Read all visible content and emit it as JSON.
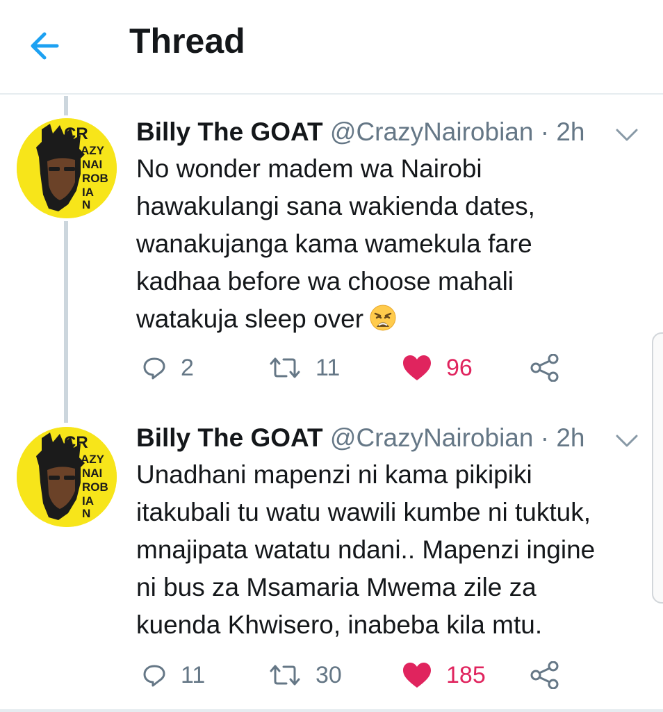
{
  "header": {
    "title": "Thread",
    "back_icon": "arrow-left-icon",
    "accent_color": "#1da1f2"
  },
  "tweets": [
    {
      "author": {
        "name": "Billy The GOAT",
        "handle": "@CrazyNairobian",
        "avatar_text": [
          "CR",
          "AZY",
          "NAI",
          "ROB",
          "IA",
          "N"
        ]
      },
      "separator": "·",
      "time": "2h",
      "text_lines": [
        "No wonder madem wa Nairobi",
        "hawakulangi sana wakienda dates,",
        "wanakujanga kama wamekula fare",
        "kadhaa before wa choose mahali",
        "watakuja sleep over"
      ],
      "emoji": "weary-face-icon",
      "stats": {
        "replies": "2",
        "retweets": "11",
        "likes": "96"
      },
      "liked": true
    },
    {
      "author": {
        "name": "Billy The GOAT",
        "handle": "@CrazyNairobian",
        "avatar_text": [
          "CR",
          "AZY",
          "NAI",
          "ROB",
          "IA",
          "N"
        ]
      },
      "separator": "·",
      "time": "2h",
      "text_lines": [
        "Unadhani mapenzi ni kama pikipiki",
        "itakubali tu watu wawili kumbe ni tuktuk,",
        "mnajipata watatu ndani.. Mapenzi ingine",
        "ni bus za Msamaria Mwema zile za",
        "kuenda Khwisero, inabeba kila mtu."
      ],
      "stats": {
        "replies": "11",
        "retweets": "30",
        "likes": "185"
      },
      "liked": true
    }
  ],
  "colors": {
    "like": "#e0245e",
    "muted": "#657786",
    "text": "#14171a",
    "avatar_bg": "#f7e51a"
  }
}
